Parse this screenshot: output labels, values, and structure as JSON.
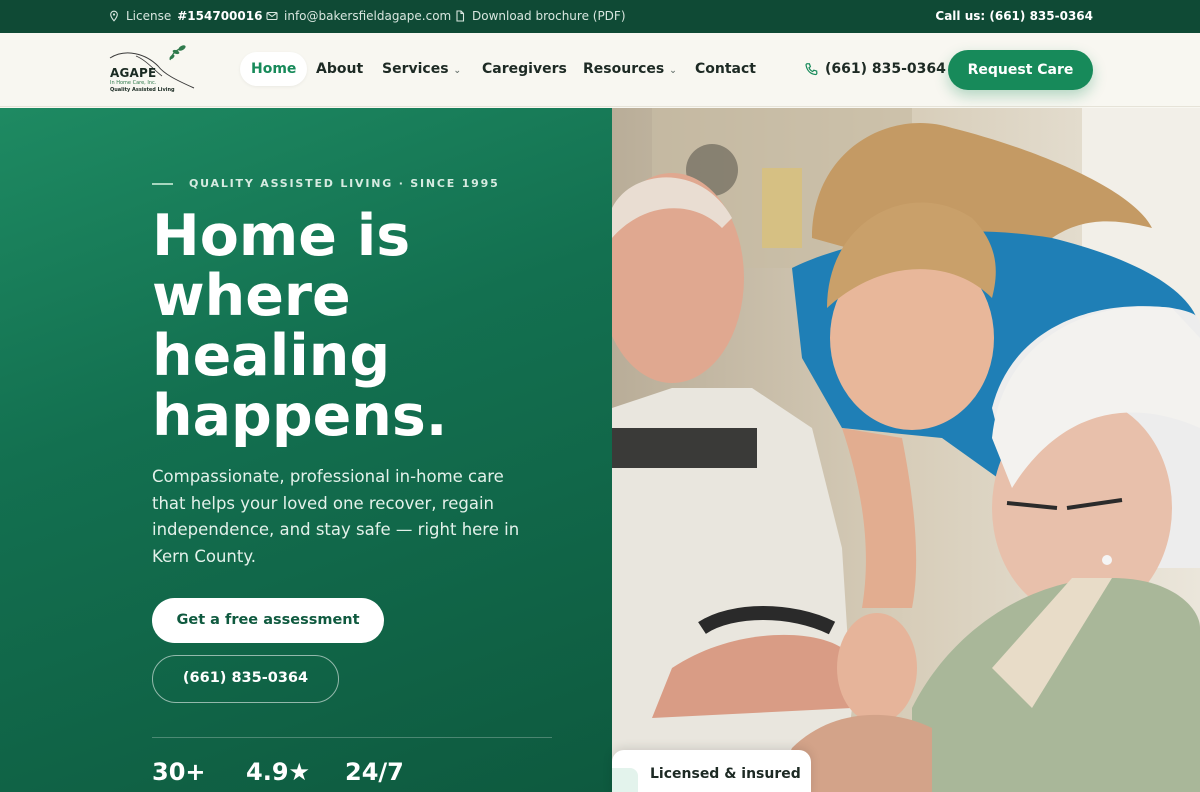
{
  "topbar": {
    "license_label": "License",
    "license_number": "#154700016",
    "email": "info@bakersfieldagape.com",
    "brochure": "Download brochure (PDF)",
    "call": "Call us: (661) 835-0364",
    "icons": [
      "location-pin-icon",
      "mail-icon",
      "document-icon"
    ]
  },
  "nav": {
    "logo": {
      "name": "AGAPE",
      "sub1": "In Home Care, Inc.",
      "sub2": "Quality Assisted Living"
    },
    "links": {
      "home": "Home",
      "about": "About",
      "services": "Services",
      "caregivers": "Caregivers",
      "resources": "Resources",
      "contact": "Contact"
    },
    "phone": "(661) 835-0364",
    "cta": "Request Care"
  },
  "hero": {
    "eyebrow": "QUALITY ASSISTED LIVING · SINCE 1995",
    "headline": "Home is where healing happens.",
    "lede": "Compassionate, professional in-home care that helps your loved one recover, regain independence, and stay safe — right here in Kern County.",
    "primary_button": "Get a free assessment",
    "secondary_button": "(661) 835-0364",
    "stats": [
      "30+",
      "4.9★",
      "24/7"
    ]
  },
  "badge": {
    "text": "Licensed & insured"
  },
  "colors": {
    "brand_dark": "#0f4a35",
    "brand": "#178a5a",
    "background": "#f8f7f1"
  }
}
